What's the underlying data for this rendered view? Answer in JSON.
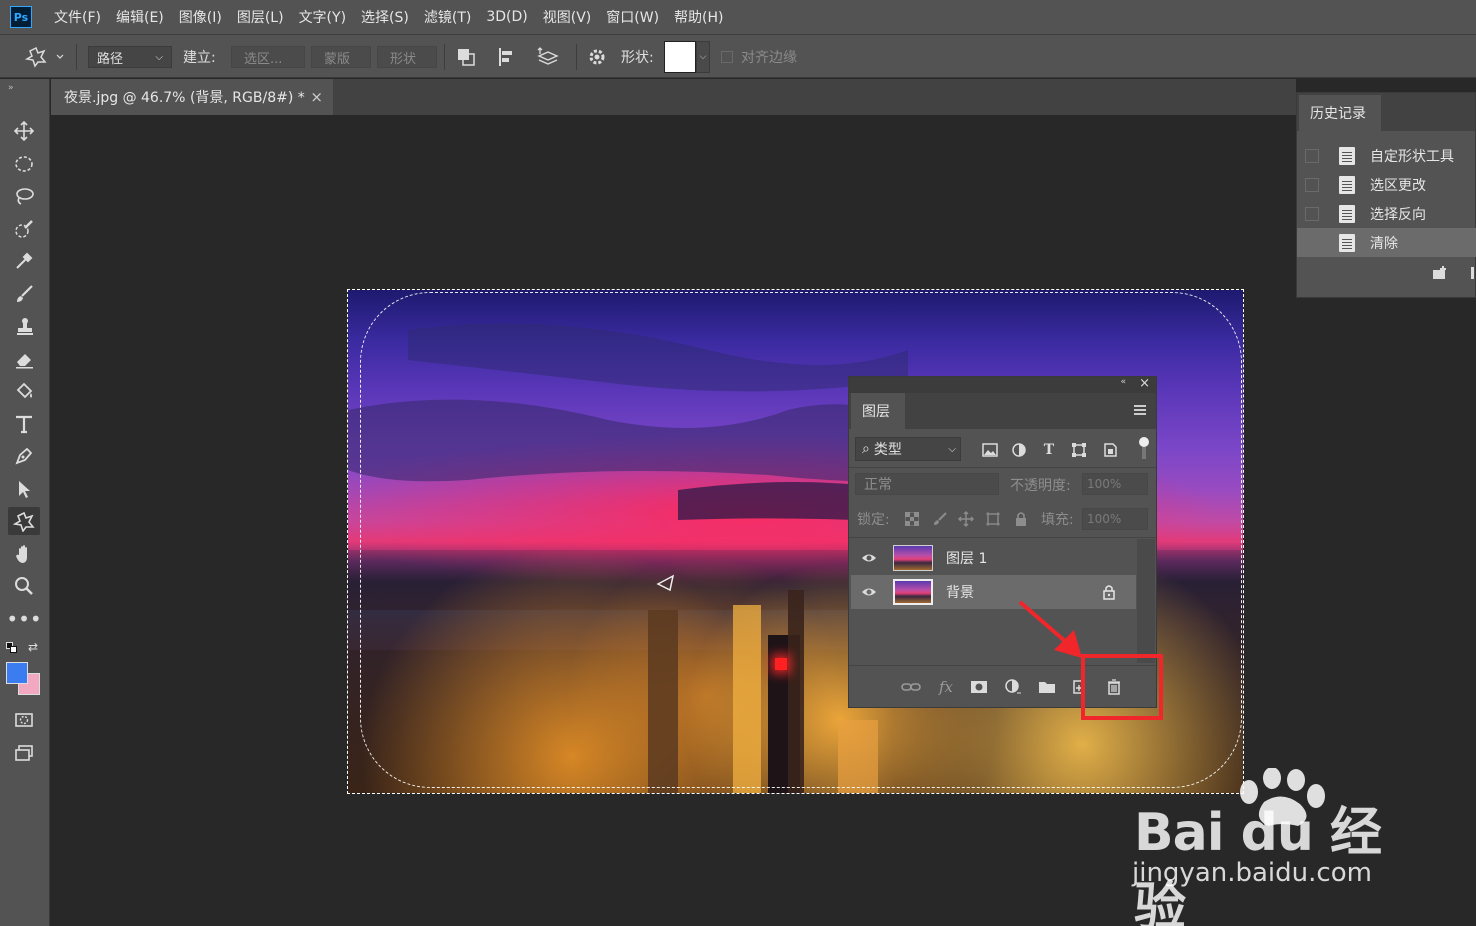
{
  "app": {
    "logo": "Ps"
  },
  "menu": [
    "文件(F)",
    "编辑(E)",
    "图像(I)",
    "图层(L)",
    "文字(Y)",
    "选择(S)",
    "滤镜(T)",
    "3D(D)",
    "视图(V)",
    "窗口(W)",
    "帮助(H)"
  ],
  "options": {
    "mode": "路径",
    "make_label": "建立:",
    "selection_btn": "选区...",
    "mask_btn": "蒙版",
    "shape_btn": "形状",
    "shape_label": "形状:",
    "align_edges": "对齐边缘"
  },
  "document": {
    "tab_title": "夜景.jpg @ 46.7% (背景, RGB/8#) *",
    "close": "×"
  },
  "history": {
    "title": "历史记录",
    "items": [
      {
        "label": "自定形状工具",
        "selected": false
      },
      {
        "label": "选区更改",
        "selected": false
      },
      {
        "label": "选择反向",
        "selected": false
      },
      {
        "label": "清除",
        "selected": true
      }
    ]
  },
  "layers": {
    "title": "图层",
    "filter": "类型",
    "blend_mode": "正常",
    "opacity_label": "不透明度:",
    "opacity_value": "100%",
    "lock_label": "锁定:",
    "fill_label": "填充:",
    "fill_value": "100%",
    "items": [
      {
        "name": "图层 1",
        "selected": false,
        "locked": false
      },
      {
        "name": "背景",
        "selected": true,
        "locked": true
      }
    ]
  },
  "colors": {
    "foreground": "#3b7cf0",
    "background": "#f2a8c0",
    "annotation": "#f0262a"
  },
  "watermark": {
    "line1": "Bai du 经验",
    "line2": "jingyan.baidu.com"
  }
}
